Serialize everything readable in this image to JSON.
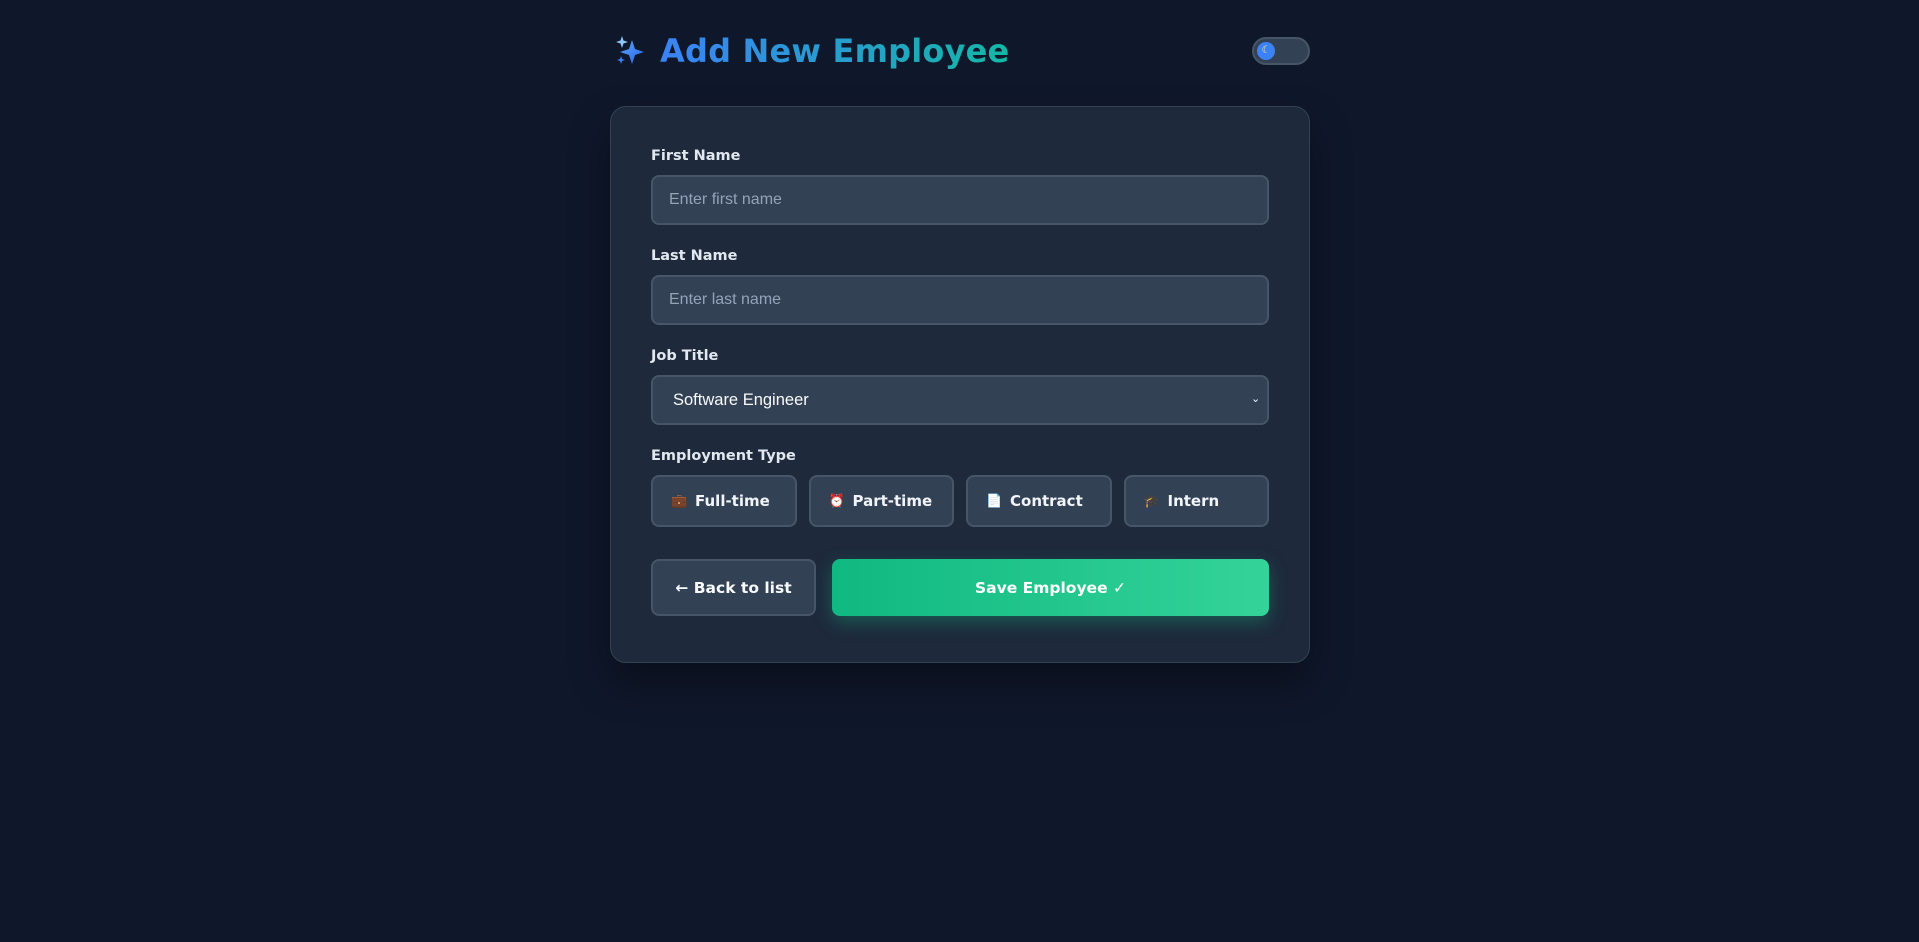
{
  "header": {
    "title": "Add New Employee",
    "title_icon": "sparkles-icon",
    "theme_toggle_icon": "moon-icon"
  },
  "form": {
    "first_name": {
      "label": "First Name",
      "value": "",
      "placeholder": "Enter first name"
    },
    "last_name": {
      "label": "Last Name",
      "value": "",
      "placeholder": "Enter last name"
    },
    "job_title": {
      "label": "Job Title",
      "selected": "Software Engineer"
    },
    "employment_type": {
      "label": "Employment Type",
      "options": [
        {
          "label": "Full-time",
          "icon": "briefcase-icon"
        },
        {
          "label": "Part-time",
          "icon": "alarm-clock-icon"
        },
        {
          "label": "Contract",
          "icon": "document-icon"
        },
        {
          "label": "Intern",
          "icon": "graduation-cap-icon"
        }
      ]
    }
  },
  "actions": {
    "back_label": "← Back to list",
    "save_label": "Save Employee ✓"
  },
  "colors": {
    "background": "#0f172a",
    "card": "#1e293b",
    "input": "#334155",
    "accent_blue": "#3b82f6",
    "accent_teal": "#14b8a6",
    "save_green": "#10b981"
  }
}
